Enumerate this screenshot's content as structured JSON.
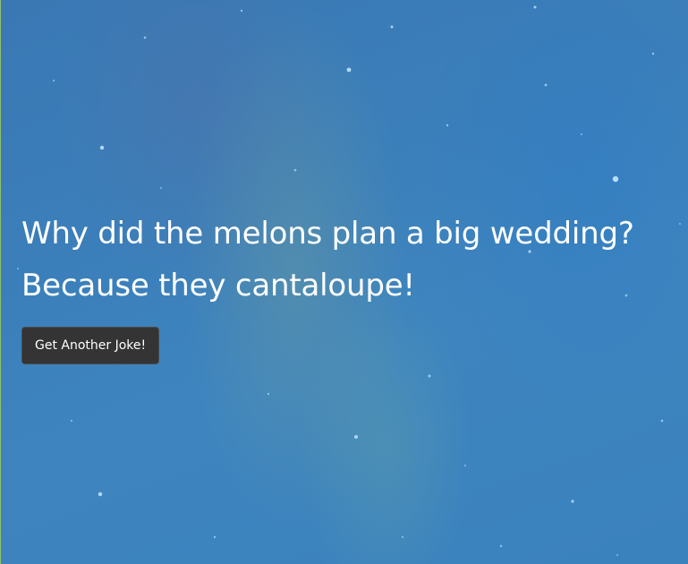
{
  "joke": {
    "setup": "Why did the melons plan a big wedding?",
    "punchline": "Because they cantaloupe!"
  },
  "actions": {
    "new_joke_label": "Get Another Joke!"
  },
  "background": {
    "icon": "nebula-starfield-image",
    "base_color": "#3b7fba"
  }
}
